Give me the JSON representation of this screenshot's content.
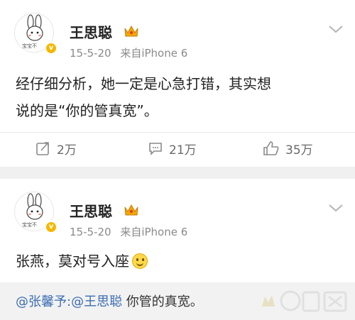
{
  "posts": [
    {
      "username": "王思聪",
      "avatar_text": "宝宝不",
      "date": "15-5-20",
      "source": "来自iPhone 6",
      "content_line1": "经仔细分析，她一定是心急打错，其实想",
      "content_line2": "说的是“你的管真宽”。",
      "actions": {
        "repost": "2万",
        "comment": "21万",
        "like": "35万"
      }
    },
    {
      "username": "王思聪",
      "avatar_text": "宝宝不",
      "date": "15-5-20",
      "source": "来自iPhone 6",
      "content": "张燕，莫对号入座"
    }
  ],
  "comment": {
    "user_mention": "@张馨予",
    "reply_mention": ":@王思聪",
    "text": " 你管的真宽。"
  },
  "icons": {
    "crown": "crown-badge-icon",
    "verified": "verified-badge-icon",
    "chevron": "chevron-down-icon",
    "repost": "repost-icon",
    "comment": "comment-icon",
    "like": "like-icon",
    "smiley": "smiley-emoji-icon"
  },
  "colors": {
    "link": "#3b6db3",
    "meta": "#8a8a8a",
    "badge": "#f5b800"
  }
}
